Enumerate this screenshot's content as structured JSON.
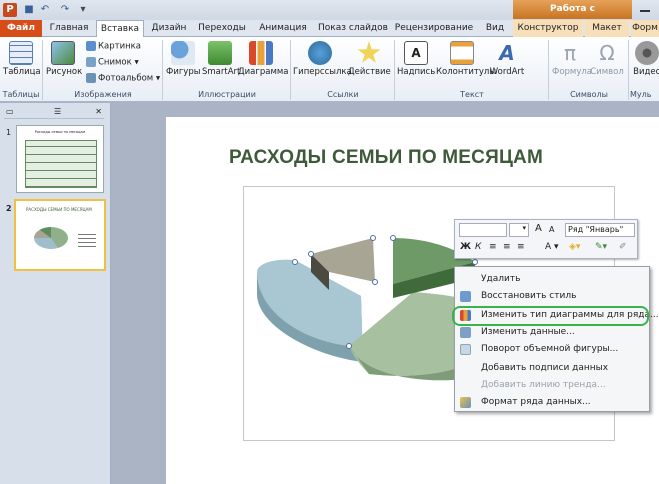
{
  "qat": {
    "context_title": "Работа с диаграммами"
  },
  "tabs": [
    {
      "label": "Файл"
    },
    {
      "label": "Главная"
    },
    {
      "label": "Вставка"
    },
    {
      "label": "Дизайн"
    },
    {
      "label": "Переходы"
    },
    {
      "label": "Анимация"
    },
    {
      "label": "Показ слайдов"
    },
    {
      "label": "Рецензирование"
    },
    {
      "label": "Вид"
    },
    {
      "label": "Конструктор"
    },
    {
      "label": "Макет"
    },
    {
      "label": "Форм"
    }
  ],
  "ribbon": {
    "groups": [
      "Таблицы",
      "Изображения",
      "Иллюстрации",
      "Ссылки",
      "Текст",
      "Символы",
      "Муль"
    ],
    "table": "Таблица",
    "picture": "Рисунок",
    "clipart": "Картинка",
    "screenshot": "Снимок",
    "photoalbum": "Фотоальбом",
    "shapes": "Фигуры",
    "smartart": "SmartArt",
    "chart": "Диаграмма",
    "hyperlink": "Гиперссылка",
    "action": "Действие",
    "textbox": "Надпись",
    "headerfooter": "Колонтитулы",
    "wordart": "WordArt",
    "equation": "Формула",
    "symbol": "Символ",
    "video": "Видео"
  },
  "slides": [
    {
      "num": "1",
      "title": "Расходы семьи по месяцам"
    },
    {
      "num": "2",
      "title": "РАСХОДЫ СЕМЬИ ПО МЕСЯЦАМ"
    }
  ],
  "slide": {
    "title": "РАСХОДЫ СЕМЬИ ПО МЕСЯЦАМ"
  },
  "minitoolbar": {
    "series": "Ряд \"Январь\"",
    "bold": "Ж",
    "italic": "К",
    "font_grow": "A",
    "font_shrink": "A"
  },
  "context_menu": [
    {
      "label": "Удалить",
      "enabled": true
    },
    {
      "label": "Восстановить стиль",
      "enabled": true
    },
    {
      "label": "Изменить тип диаграммы для ряда...",
      "enabled": true
    },
    {
      "label": "Изменить данные...",
      "enabled": true
    },
    {
      "label": "Поворот объемной фигуры...",
      "enabled": true
    },
    {
      "label": "Добавить подписи данных",
      "enabled": true
    },
    {
      "label": "Добавить линию тренда...",
      "enabled": false
    },
    {
      "label": "Формат ряда данных...",
      "enabled": true
    }
  ],
  "colors": {
    "file_tab": "#d64d1a",
    "context_tab": "#c97420",
    "title_green": "#3e5a3a",
    "highlight": "#3bb34a",
    "pie_blue": "#9fbdca",
    "pie_gray": "#a9a594",
    "pie_green": "#8fb08a",
    "pie_darkgreen": "#5f8c5a"
  }
}
